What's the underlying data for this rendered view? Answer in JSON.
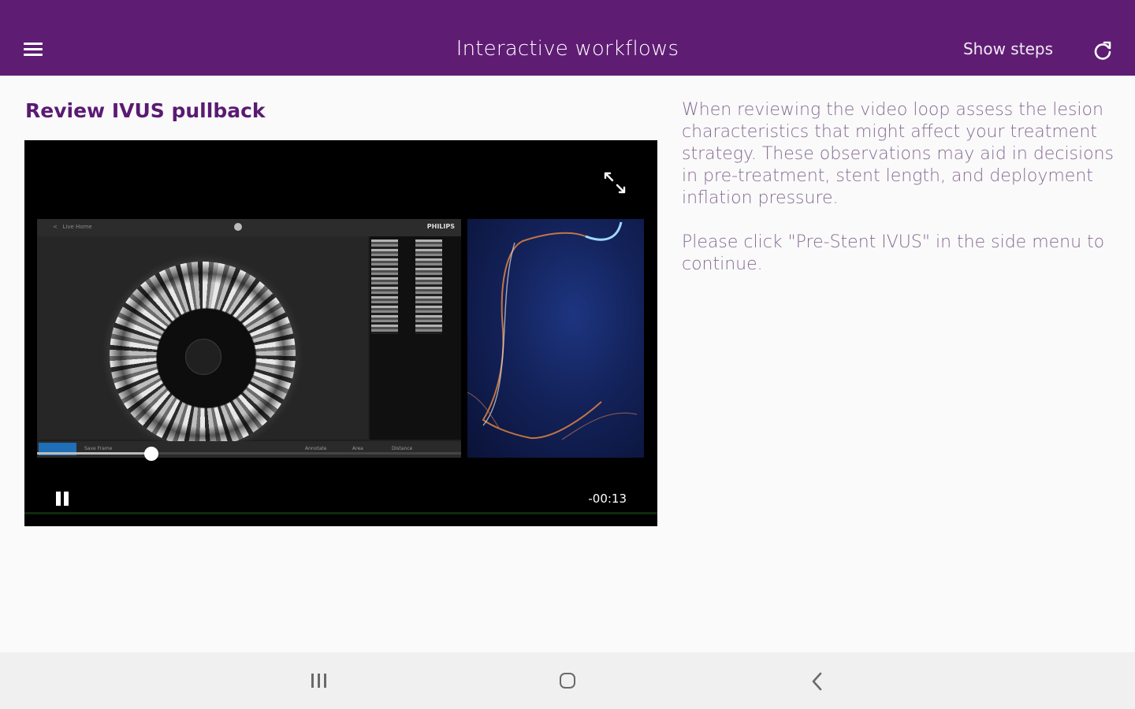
{
  "appbar": {
    "title": "Interactive workflows",
    "show_steps_label": "Show steps",
    "background_color": "#5e1d73",
    "icons": [
      "menu-icon",
      "refresh-icon"
    ]
  },
  "content": {
    "section_title": "Review IVUS pullback",
    "description_1": "When reviewing the video loop assess the lesion characteristics that might affect your treatment strategy. These observations may aid in decisions in pre-treatment, stent length, and deployment inflation pressure.",
    "description_2": "Please click \"Pre-Stent IVUS\" in the side menu to continue."
  },
  "video": {
    "time_remaining": "-00:13",
    "brand_label": "PHILIPS",
    "playback_progress_fraction": 0.27,
    "state": "playing",
    "icons": [
      "expand-icon",
      "pause-icon"
    ]
  },
  "system_nav": {
    "icons": [
      "recent-apps-icon",
      "home-icon",
      "back-icon"
    ]
  }
}
